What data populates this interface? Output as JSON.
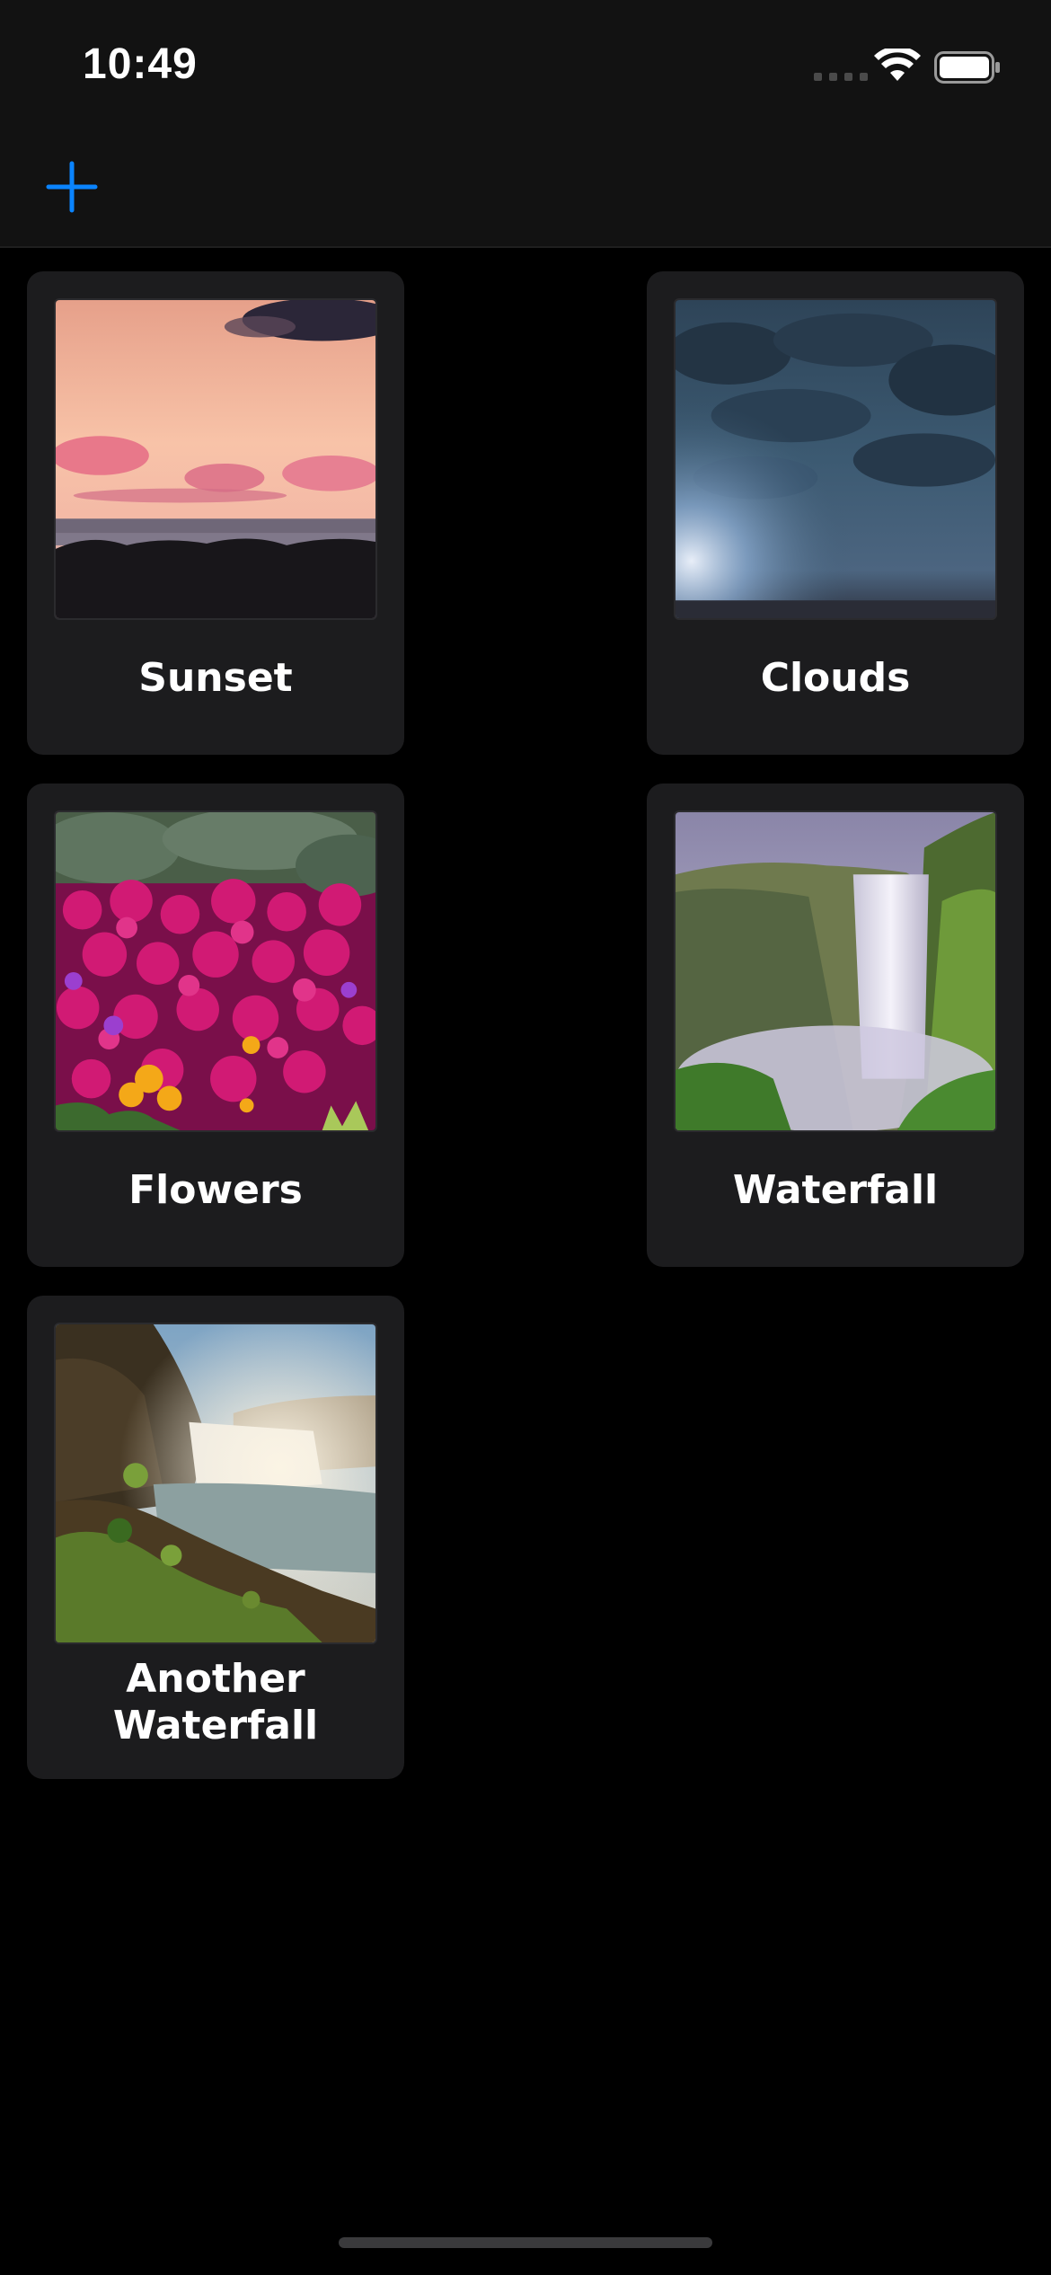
{
  "status_bar": {
    "time": "10:49",
    "icons": [
      "cellular-signal-icon",
      "wifi-icon",
      "battery-icon"
    ]
  },
  "nav_bar": {
    "add_icon": "plus-icon",
    "accent_color": "#0a84ff"
  },
  "cards": [
    {
      "title": "Sunset",
      "image": "sunset-photo"
    },
    {
      "title": "Clouds",
      "image": "clouds-photo"
    },
    {
      "title": "Flowers",
      "image": "flowers-photo"
    },
    {
      "title": "Waterfall",
      "image": "waterfall-photo"
    },
    {
      "title": "Another Waterfall",
      "image": "another-waterfall-photo"
    }
  ],
  "colors": {
    "background": "#000000",
    "card_background": "#1c1c1e",
    "bar_background": "#121212"
  }
}
